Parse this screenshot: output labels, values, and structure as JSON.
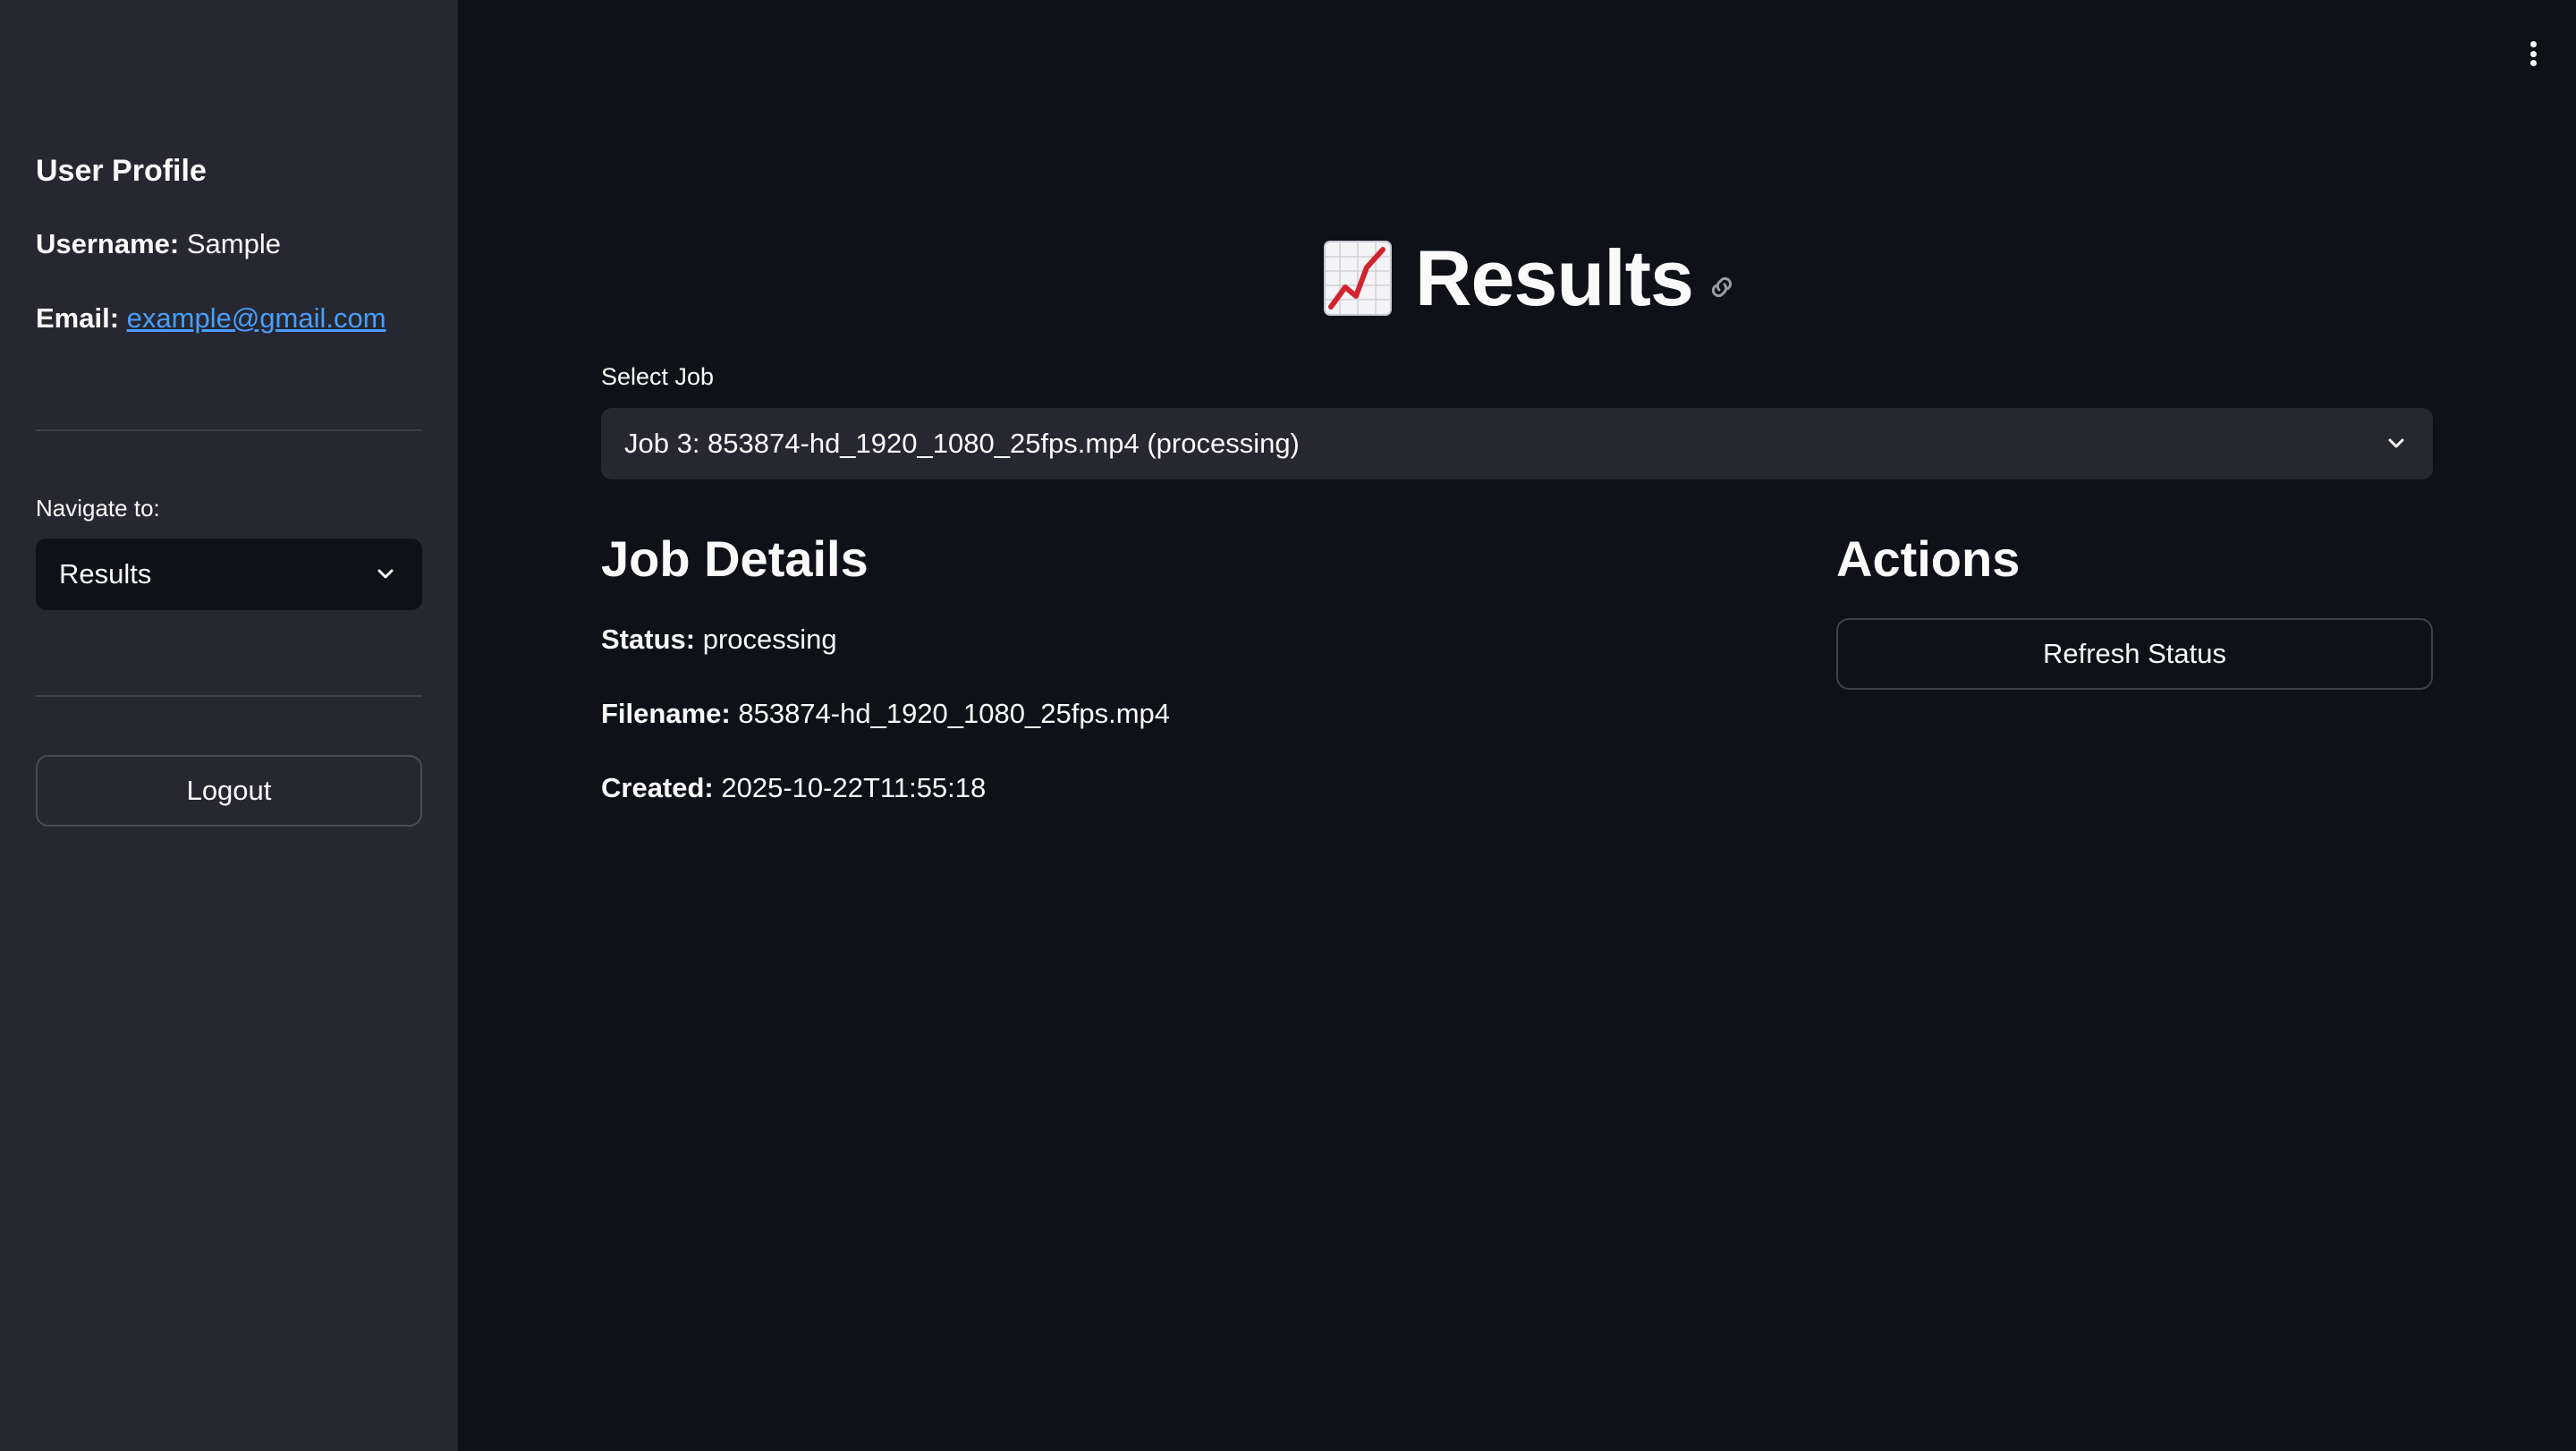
{
  "sidebar": {
    "heading": "User Profile",
    "username_label": "Username:",
    "username_value": "Sample",
    "email_label": "Email:",
    "email_value": "example@gmail.com",
    "nav_label": "Navigate to:",
    "nav_selected": "Results",
    "logout_label": "Logout"
  },
  "main": {
    "title": "Results",
    "title_icon": "chart-increasing-icon",
    "select_job_label": "Select Job",
    "select_job_value": "Job 3: 853874-hd_1920_1080_25fps.mp4 (processing)",
    "job_details_heading": "Job Details",
    "status_label": "Status:",
    "status_value": "processing",
    "filename_label": "Filename:",
    "filename_value": "853874-hd_1920_1080_25fps.mp4",
    "created_label": "Created:",
    "created_value": "2025-10-22T11:55:18",
    "actions_heading": "Actions",
    "refresh_label": "Refresh Status"
  },
  "colors": {
    "background": "#0e1117",
    "sidebar": "#262730",
    "link": "#4a9eff",
    "text": "#fafafa"
  }
}
